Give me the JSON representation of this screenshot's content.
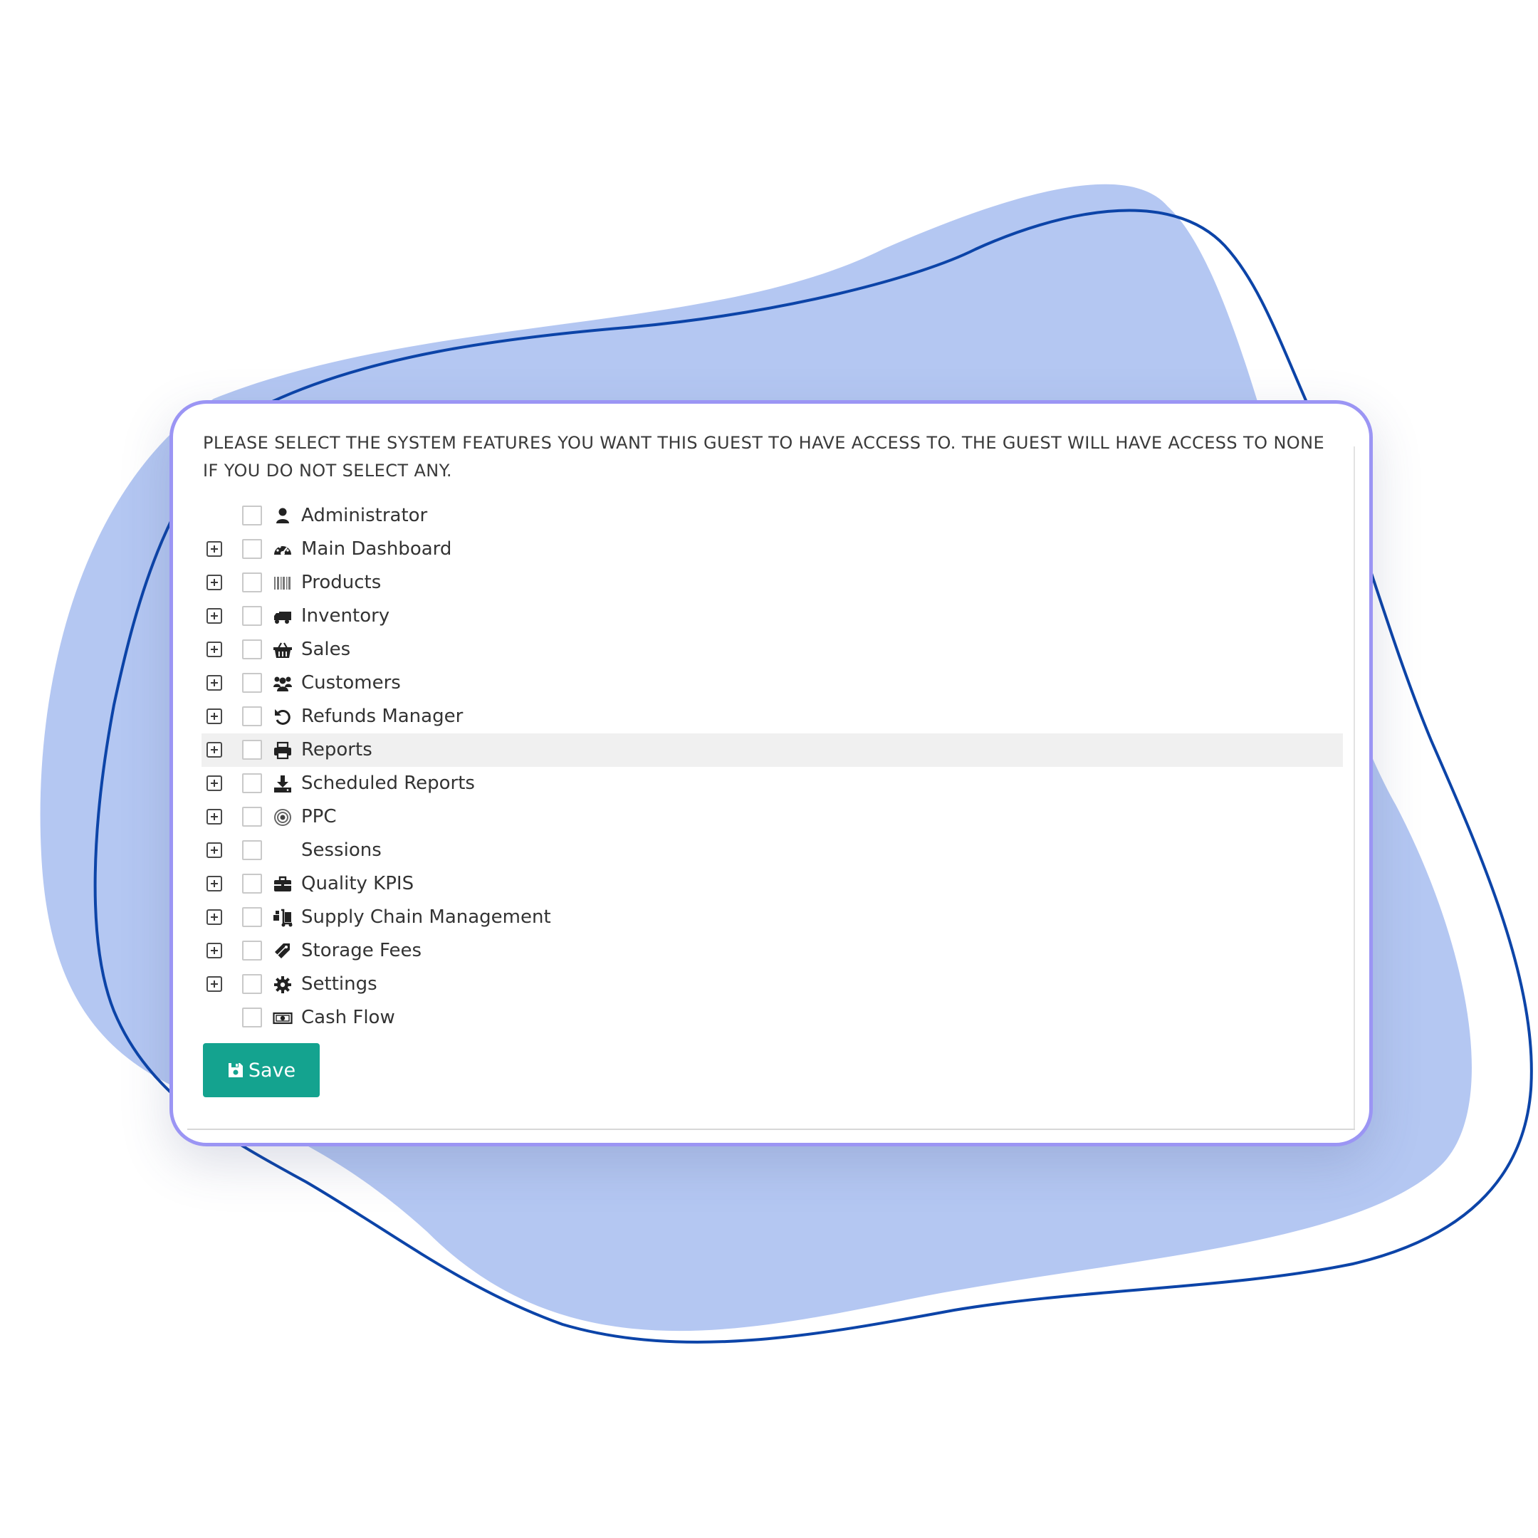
{
  "instructions": "PLEASE SELECT THE SYSTEM FEATURES YOU WANT THIS GUEST TO HAVE ACCESS TO. THE GUEST WILL HAVE ACCESS TO NONE IF YOU DO NOT SELECT ANY.",
  "features": [
    {
      "label": "Administrator",
      "icon": "user-icon",
      "expandable": false,
      "checked": false
    },
    {
      "label": "Main Dashboard",
      "icon": "dashboard-icon",
      "expandable": true,
      "checked": false
    },
    {
      "label": "Products",
      "icon": "barcode-icon",
      "expandable": true,
      "checked": false
    },
    {
      "label": "Inventory",
      "icon": "truck-icon",
      "expandable": true,
      "checked": false
    },
    {
      "label": "Sales",
      "icon": "basket-icon",
      "expandable": true,
      "checked": false
    },
    {
      "label": "Customers",
      "icon": "users-icon",
      "expandable": true,
      "checked": false
    },
    {
      "label": "Refunds Manager",
      "icon": "undo-icon",
      "expandable": true,
      "checked": false
    },
    {
      "label": "Reports",
      "icon": "print-icon",
      "expandable": true,
      "checked": false,
      "highlighted": true
    },
    {
      "label": "Scheduled Reports",
      "icon": "download-icon",
      "expandable": true,
      "checked": false
    },
    {
      "label": "PPC",
      "icon": "target-icon",
      "expandable": true,
      "checked": false
    },
    {
      "label": "Sessions",
      "icon": "",
      "expandable": true,
      "checked": false
    },
    {
      "label": "Quality KPIS",
      "icon": "briefcase-icon",
      "expandable": true,
      "checked": false
    },
    {
      "label": "Supply Chain Management",
      "icon": "dolly-icon",
      "expandable": true,
      "checked": false
    },
    {
      "label": "Storage Fees",
      "icon": "tags-icon",
      "expandable": true,
      "checked": false
    },
    {
      "label": "Settings",
      "icon": "gear-icon",
      "expandable": true,
      "checked": false
    },
    {
      "label": "Cash Flow",
      "icon": "money-icon",
      "expandable": false,
      "checked": false
    }
  ],
  "save_button": {
    "label": "Save",
    "icon": "floppy-disk-icon"
  },
  "colors": {
    "blob_fill": "#b4c7f2",
    "outline_stroke": "#0c44a8",
    "card_border": "#9b95f4",
    "save_button": "#14a38f",
    "row_highlight": "#f0f0f0"
  }
}
